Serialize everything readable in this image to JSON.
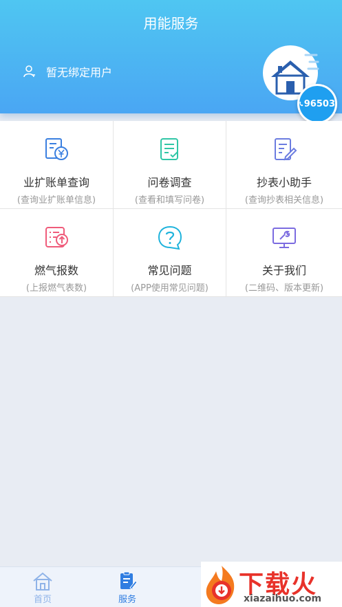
{
  "header": {
    "title": "用能服务",
    "user_text": "暂无绑定用户",
    "phone_number": "96503"
  },
  "grid": [
    {
      "title": "业扩账单查询",
      "subtitle": "(查询业扩账单信息)",
      "icon": "bill-yuan-icon",
      "color": "#3a7fe0"
    },
    {
      "title": "问卷调查",
      "subtitle": "(查看和填写问卷)",
      "icon": "questionnaire-icon",
      "color": "#2fc6a6"
    },
    {
      "title": "抄表小助手",
      "subtitle": "(查询抄表相关信息)",
      "icon": "meter-edit-icon",
      "color": "#6b7ce0"
    },
    {
      "title": "燃气报数",
      "subtitle": "(上报燃气表数)",
      "icon": "gas-report-icon",
      "color": "#ef5b7a"
    },
    {
      "title": "常见问题",
      "subtitle": "(APP使用常见问题)",
      "icon": "question-bubble-icon",
      "color": "#1fb3dc"
    },
    {
      "title": "关于我们",
      "subtitle": "(二维码、版本更新)",
      "icon": "monitor-wrench-icon",
      "color": "#7b6be0"
    }
  ],
  "tabbar": {
    "home_label": "首页",
    "service_label": "服务"
  },
  "watermark": {
    "brand": "下载火",
    "url": "xiazaihuo.com"
  },
  "colors": {
    "header_top": "#4fc6f2",
    "header_bottom": "#4aa6f3",
    "active_tab": "#2f7de1",
    "watermark_red": "#e8322a"
  }
}
